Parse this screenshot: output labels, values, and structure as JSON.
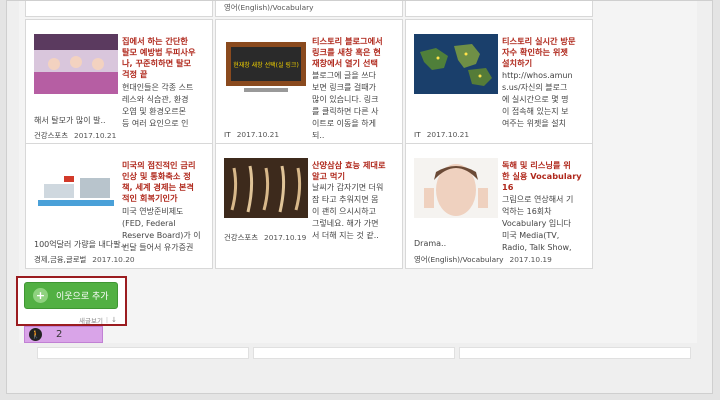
{
  "posts": [
    {
      "title": "집에서 하는 간단한\n탈모 예방법 두피사우\n나, 꾸준히하면 탈모\n걱정 끝",
      "excerpt": "현대인들은 각종 스트\n레스와 식습관, 환경\n오염 및 환경오르몬\n등 여러 요인으로 인",
      "tail": "해서 탈모가 많이 발..",
      "category": "건강스포츠",
      "date": "2017.10.21"
    },
    {
      "title": "티스토리 블로그에서\n링크를 새창 혹은 현\n재창에서 열기 선택",
      "excerpt": "블로그에 글을 쓰다\n보면 링크를 걸때가\n많이 있습니다. 링크\n를 클릭하면 다른 사\n이트로 이동을 하게\n되..",
      "tail": "",
      "category": "IT",
      "date": "2017.10.21",
      "thumb_text": "현재창 새창 선택(실 링크)"
    },
    {
      "title": "티스토리 실시간 방문\n자수 확인하는 위젯\n설치하기",
      "excerpt": "http://whos.amun\ns.us/자신의 블로그\n에 실시간으로 몇 명\n이 접속해 있는지 보\n여주는 위젯을 설치",
      "tail": "",
      "category": "IT",
      "date": "2017.10.21"
    },
    {
      "title": "미국의 점진적인 금리\n인상 및 통화축소 정\n책, 세계 경제는 본격\n적인 회복기인가",
      "excerpt": "미국 연방준비제도\n(FED, Federal\nReserve Board)가 이\n번달 들어서 유가증권",
      "tail": "100억달러 가량을 내다팔..",
      "category": "경제,금융,글로벌",
      "date": "2017.10.20"
    },
    {
      "title": "산양삼삼 효능 제대로\n알고 먹기",
      "excerpt": "날씨가 갑자기면 더워\n잠 타고 추워지면 몸\n이 괜히 으시시하고\n그렇네요. 해가 가면\n서 더해 지는 것 같..",
      "tail": "",
      "category": "건강스포츠",
      "date": "2017.10.19"
    },
    {
      "title": "독해 및 리스닝를 위\n한 실용 Vocabulary\n16",
      "excerpt": "그림으로 연상해서 기\n억하는 16회차\nVocabulary 입니다\n미국 Media(TV,\nRadio, Talk Show,",
      "tail": "Drama..",
      "category": "영어(English)/Vocabulary",
      "date": "2017.10.19"
    }
  ],
  "top_cut": "영어(English)/Vocabulary",
  "add_neighbor": {
    "label": "이웃으로 추가",
    "plus": "+"
  },
  "feed": {
    "label": "새글보기",
    "sep": "|",
    "download": "↓"
  },
  "counter": {
    "value": "2"
  }
}
